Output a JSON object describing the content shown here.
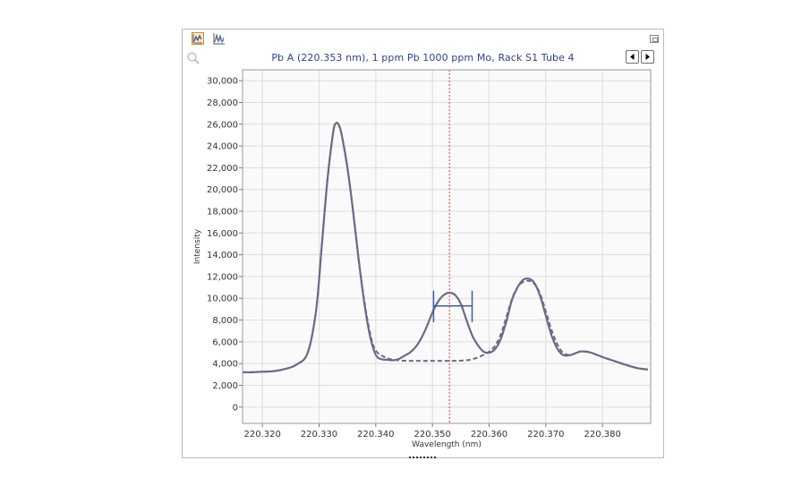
{
  "window": {
    "title": "Pb A (220.353 nm), 1 ppm Pb 1000 ppm Mo, Rack S1 Tube 4",
    "toolbar": {
      "active_icon": "spectrum-view-icon",
      "second_icon": "overlay-view-icon",
      "restore_icon": "restore-window-icon"
    },
    "navigation": {
      "prev_icon": "arrow-left-icon",
      "next_icon": "arrow-right-icon"
    },
    "zoom_icon": "magnifier-icon"
  },
  "chart_data": {
    "type": "line",
    "title": "Pb A (220.353 nm), 1 ppm Pb 1000 ppm Mo, Rack S1 Tube 4",
    "xlabel": "Wavelength (nm)",
    "ylabel": "Intensity",
    "xlim": [
      220.3165,
      220.3885
    ],
    "ylim": [
      -1500,
      31000
    ],
    "x_ticks": [
      220.32,
      220.33,
      220.34,
      220.35,
      220.36,
      220.37,
      220.38
    ],
    "x_tick_labels": [
      "220.320",
      "220.330",
      "220.340",
      "220.350",
      "220.360",
      "220.370",
      "220.380"
    ],
    "y_ticks": [
      0,
      2000,
      4000,
      6000,
      8000,
      10000,
      12000,
      14000,
      16000,
      18000,
      20000,
      22000,
      24000,
      26000,
      28000,
      30000
    ],
    "y_tick_labels": [
      "0",
      "2,000",
      "4,000",
      "6,000",
      "8,000",
      "10,000",
      "12,000",
      "14,000",
      "16,000",
      "18,000",
      "20,000",
      "22,000",
      "24,000",
      "26,000",
      "28,000",
      "30,000"
    ],
    "grid": true,
    "legend": "none",
    "marker_line": {
      "x": 220.353,
      "color": "#d93a3a",
      "style": "dotted"
    },
    "integration_window": {
      "x_start": 220.3502,
      "x_end": 220.357,
      "y": 9300,
      "y_min": 7800,
      "y_max": 10700,
      "color": "#3f5fa8"
    },
    "series": [
      {
        "style": "solid",
        "color": "#6d6a86",
        "x": [
          220.3165,
          220.318,
          220.32,
          220.322,
          220.324,
          220.326,
          220.328,
          220.3295,
          220.3305,
          220.3315,
          220.3325,
          220.333,
          220.3335,
          220.334,
          220.335,
          220.336,
          220.337,
          220.338,
          220.339,
          220.34,
          220.341,
          220.342,
          220.343,
          220.344,
          220.345,
          220.346,
          220.347,
          220.348,
          220.349,
          220.35,
          220.351,
          220.352,
          220.353,
          220.354,
          220.355,
          220.356,
          220.357,
          220.358,
          220.359,
          220.36,
          220.361,
          220.362,
          220.363,
          220.364,
          220.365,
          220.366,
          220.367,
          220.368,
          220.369,
          220.37,
          220.371,
          220.372,
          220.373,
          220.374,
          220.375,
          220.376,
          220.377,
          220.378,
          220.379,
          220.38,
          220.382,
          220.384,
          220.386,
          220.388
        ],
        "y": [
          3200,
          3200,
          3250,
          3300,
          3500,
          3900,
          5000,
          9000,
          15000,
          21000,
          25300,
          26100,
          25900,
          25000,
          22000,
          18000,
          13500,
          9500,
          6500,
          4800,
          4400,
          4350,
          4300,
          4400,
          4700,
          5000,
          5500,
          6300,
          7400,
          8700,
          9700,
          10300,
          10500,
          10300,
          9500,
          8000,
          6600,
          5700,
          5100,
          5000,
          5300,
          6200,
          7800,
          9800,
          11000,
          11700,
          11800,
          11400,
          10200,
          8400,
          6600,
          5400,
          4800,
          4750,
          4900,
          5100,
          5100,
          5000,
          4800,
          4600,
          4250,
          3900,
          3600,
          3450
        ]
      },
      {
        "style": "dashed",
        "color": "#6d6a86",
        "x": [
          220.3165,
          220.318,
          220.32,
          220.322,
          220.324,
          220.326,
          220.328,
          220.3295,
          220.3305,
          220.3315,
          220.3325,
          220.333,
          220.3335,
          220.334,
          220.335,
          220.336,
          220.337,
          220.338,
          220.339,
          220.34,
          220.342,
          220.344,
          220.346,
          220.348,
          220.35,
          220.352,
          220.354,
          220.356,
          220.357,
          220.358,
          220.359,
          220.36,
          220.361,
          220.362,
          220.363,
          220.364,
          220.365,
          220.366,
          220.367,
          220.368,
          220.369,
          220.37,
          220.371,
          220.372,
          220.373,
          220.374,
          220.375,
          220.376,
          220.377,
          220.378,
          220.379,
          220.38,
          220.382,
          220.384,
          220.386,
          220.388
        ],
        "y": [
          3200,
          3200,
          3250,
          3300,
          3500,
          3900,
          5000,
          9000,
          15000,
          21000,
          25300,
          26100,
          25900,
          25000,
          22000,
          18000,
          13500,
          9700,
          6800,
          5200,
          4500,
          4300,
          4250,
          4250,
          4250,
          4250,
          4250,
          4300,
          4400,
          4550,
          4800,
          5100,
          5600,
          6600,
          8200,
          9900,
          11000,
          11500,
          11600,
          11300,
          10400,
          8800,
          7100,
          5800,
          5000,
          4800,
          4900,
          5100,
          5100,
          5000,
          4800,
          4600,
          4250,
          3900,
          3600,
          3450
        ]
      }
    ]
  }
}
